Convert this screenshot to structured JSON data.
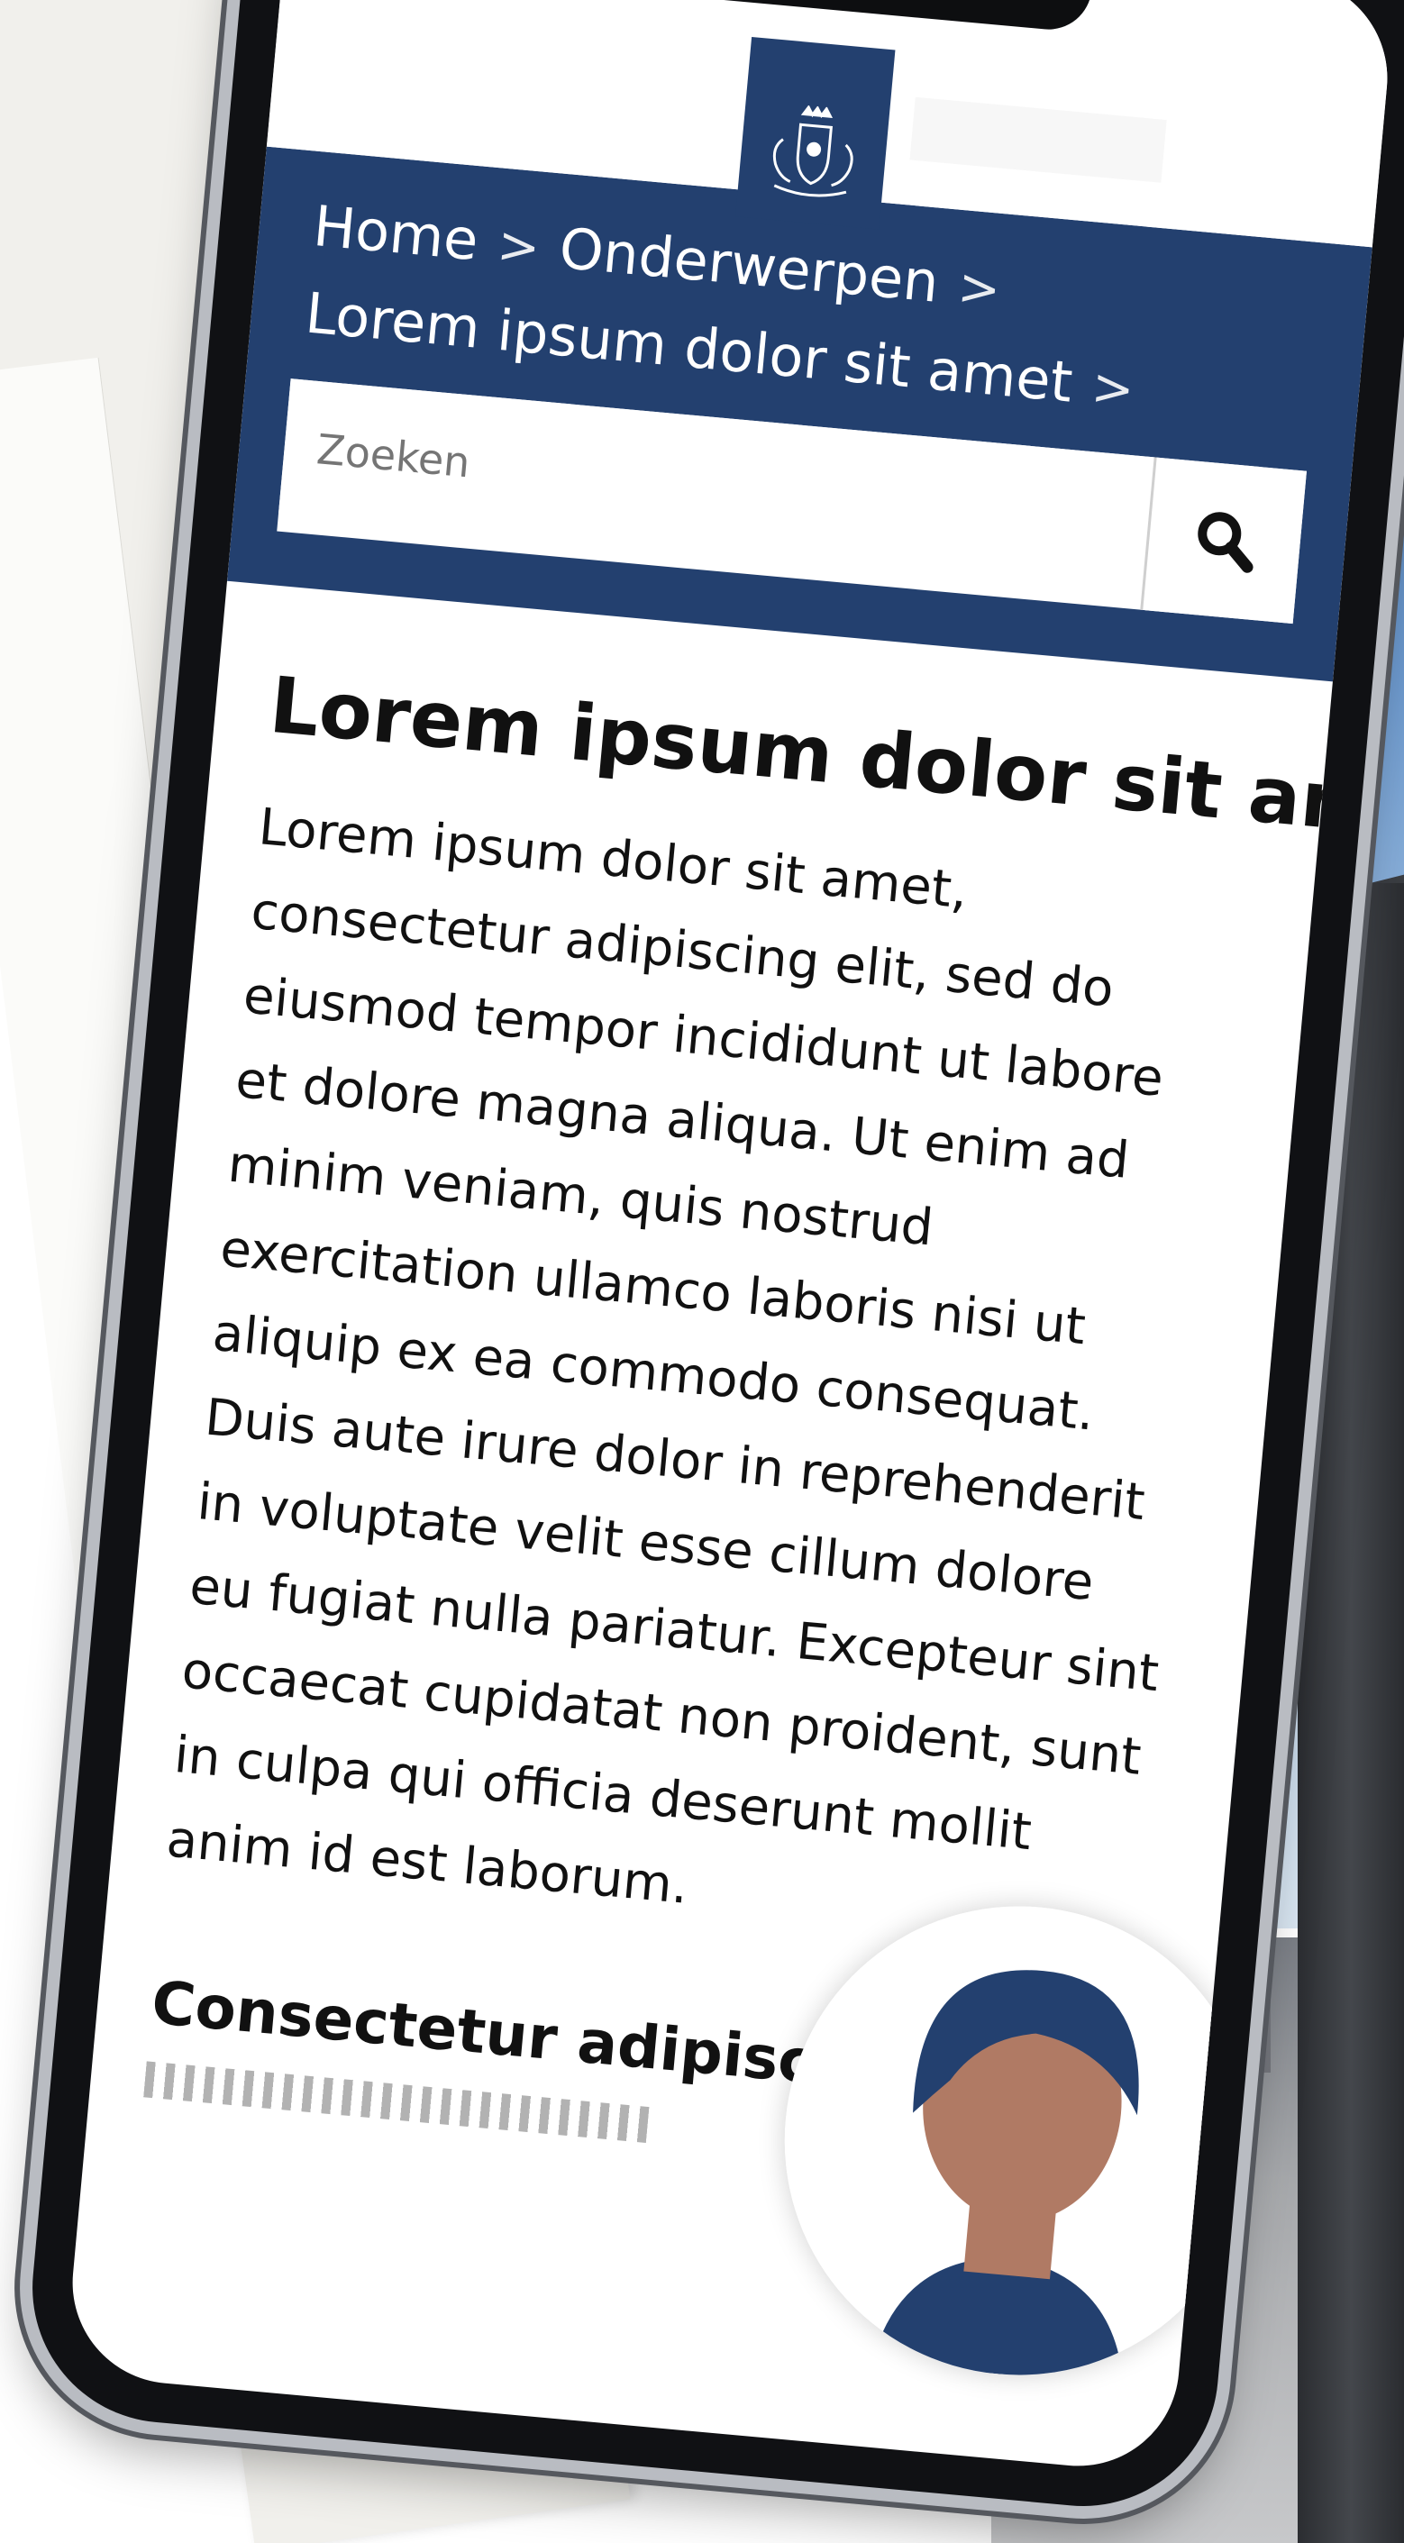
{
  "site": {
    "brand_color": "#23406f",
    "logo_icon": "coat-of-arms-icon"
  },
  "breadcrumb": {
    "items": [
      "Home",
      "Onderwerpen",
      "Lorem ipsum dolor sit amet"
    ],
    "separator": ">"
  },
  "search": {
    "placeholder": "Zoeken",
    "button_icon": "search-icon"
  },
  "article": {
    "title": "Lorem ipsum dolor sit amet",
    "body": "Lorem ipsum dolor sit amet, consectetur adipiscing elit, sed do eiusmod tempor incididunt ut labore et dolore magna aliqua. Ut enim ad minim veniam, quis nostrud exercitation ullamco laboris nisi ut aliquip ex ea commodo consequat. Duis aute irure dolor in reprehenderit in voluptate velit esse cillum dolore eu fugiat nulla pariatur. Excepteur sint occaecat cupidatat non proident, sunt in culpa qui officia deserunt mollit anim id est laborum.",
    "subheading": "Consectetur adipiscing elit"
  },
  "assistant": {
    "icon": "person-avatar-icon"
  }
}
